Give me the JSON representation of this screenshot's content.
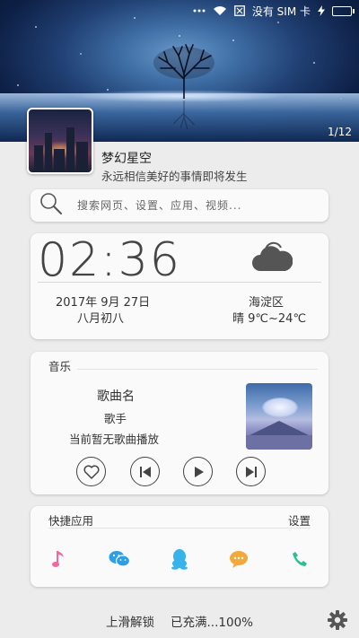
{
  "status_bar": {
    "carrier": "没有 SIM 卡",
    "icons": [
      "more-dots-icon",
      "wifi-icon",
      "no-sim-icon",
      "charging-bolt-icon",
      "battery-full-icon"
    ]
  },
  "wallpaper": {
    "page_indicator": "1/12"
  },
  "profile": {
    "title": "梦幻星空",
    "subtitle": "永远相信美好的事情即将发生"
  },
  "search": {
    "placeholder": "搜索网页、设置、应用、视频..."
  },
  "clock": {
    "time": "02:36",
    "date": "2017年 9月 27日",
    "lunar": "八月初八",
    "district": "海淀区",
    "weather": "晴 9℃~24℃",
    "weather_icon": "cloudy-icon"
  },
  "music": {
    "heading": "音乐",
    "song_title": "歌曲名",
    "artist": "歌手",
    "status": "当前暂无歌曲播放"
  },
  "apps": {
    "heading": "快捷应用",
    "settings_label": "设置",
    "items": [
      {
        "name": "music",
        "icon": "music-note-icon",
        "color": "#ee6aa0"
      },
      {
        "name": "wechat",
        "icon": "wechat-icon",
        "color": "#2c9fe6"
      },
      {
        "name": "qq",
        "icon": "qq-penguin-icon",
        "color": "#36b3e8"
      },
      {
        "name": "message",
        "icon": "message-bubble-icon",
        "color": "#f2a93b"
      },
      {
        "name": "phone",
        "icon": "phone-icon",
        "color": "#2bbf94"
      }
    ]
  },
  "footer": {
    "unlock_hint": "上滑解锁",
    "battery_status": "已充满...100%"
  },
  "colors": {
    "background": "#ececec",
    "card": "#fafafa",
    "text": "#333333"
  }
}
